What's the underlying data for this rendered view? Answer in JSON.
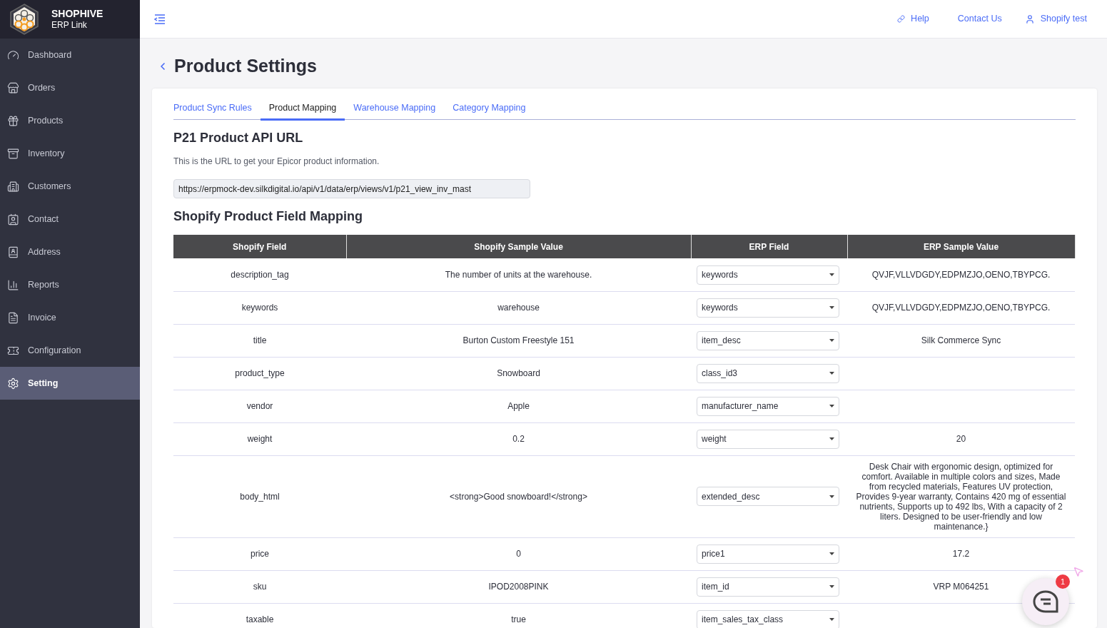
{
  "brand": {
    "name": "SHOPHIVE",
    "subtitle": "ERP Link"
  },
  "sidebar": {
    "items": [
      {
        "label": "Dashboard",
        "selected": false
      },
      {
        "label": "Orders",
        "selected": false
      },
      {
        "label": "Products",
        "selected": false
      },
      {
        "label": "Inventory",
        "selected": false
      },
      {
        "label": "Customers",
        "selected": false
      },
      {
        "label": "Contact",
        "selected": false
      },
      {
        "label": "Address",
        "selected": false
      },
      {
        "label": "Reports",
        "selected": false
      },
      {
        "label": "Invoice",
        "selected": false
      },
      {
        "label": "Configuration",
        "selected": false
      },
      {
        "label": "Setting",
        "selected": true
      }
    ]
  },
  "topbar": {
    "links": [
      "Help",
      "Contact Us",
      "Shopify test"
    ]
  },
  "page": {
    "title": "Product Settings"
  },
  "tabs": [
    {
      "label": "Product Sync Rules",
      "selected": false
    },
    {
      "label": "Product Mapping",
      "selected": true
    },
    {
      "label": "Warehouse Mapping",
      "selected": false
    },
    {
      "label": "Category Mapping",
      "selected": false
    }
  ],
  "api_section": {
    "heading": "P21 Product API URL",
    "description": "This is the URL to get your Epicor product information.",
    "url": "https://erpmock-dev.silkdigital.io/api/v1/data/erp/views/v1/p21_view_inv_mast"
  },
  "mapping_section": {
    "heading": "Shopify Product Field Mapping"
  },
  "table": {
    "columns": [
      "Shopify Field",
      "Shopify Sample Value",
      "ERP Field",
      "ERP Sample Value"
    ],
    "rows": [
      {
        "shopify_field": "description_tag",
        "shopify_sample": "The number of units at the warehouse.",
        "erp_field": "keywords",
        "erp_sample": "QVJF,VLLVDGDY,EDPMZJO,OENO,TBYPCG."
      },
      {
        "shopify_field": "keywords",
        "shopify_sample": "warehouse",
        "erp_field": "keywords",
        "erp_sample": "QVJF,VLLVDGDY,EDPMZJO,OENO,TBYPCG."
      },
      {
        "shopify_field": "title",
        "shopify_sample": "Burton Custom Freestyle 151",
        "erp_field": "item_desc",
        "erp_sample": "Silk Commerce Sync"
      },
      {
        "shopify_field": "product_type",
        "shopify_sample": "Snowboard",
        "erp_field": "class_id3"
      },
      {
        "shopify_field": "vendor",
        "shopify_sample": "Apple",
        "erp_field": "manufacturer_name"
      },
      {
        "shopify_field": "weight",
        "shopify_sample": "0.2",
        "erp_field": "weight",
        "erp_sample": "20"
      },
      {
        "shopify_field": "body_html",
        "shopify_sample": "<strong>Good snowboard!</strong>",
        "erp_field": "extended_desc",
        "erp_sample": "Desk Chair with ergonomic design, optimized for comfort. Available in multiple colors and sizes, Made from recycled materials, Features UV protection, Provides 9-year warranty, Contains 420 mg of essential nutrients, Supports up to 492 lbs, With a capacity of 2 liters. Designed to be user-friendly and low maintenance.}"
      },
      {
        "shopify_field": "price",
        "shopify_sample": "0",
        "erp_field": "price1",
        "erp_sample": "17.2"
      },
      {
        "shopify_field": "sku",
        "shopify_sample": "IPOD2008PINK",
        "erp_field": "item_id",
        "erp_sample": "VRP M064251"
      },
      {
        "shopify_field": "taxable",
        "shopify_sample": "true",
        "erp_field": "item_sales_tax_class"
      }
    ]
  },
  "chat": {
    "badge": "1"
  }
}
